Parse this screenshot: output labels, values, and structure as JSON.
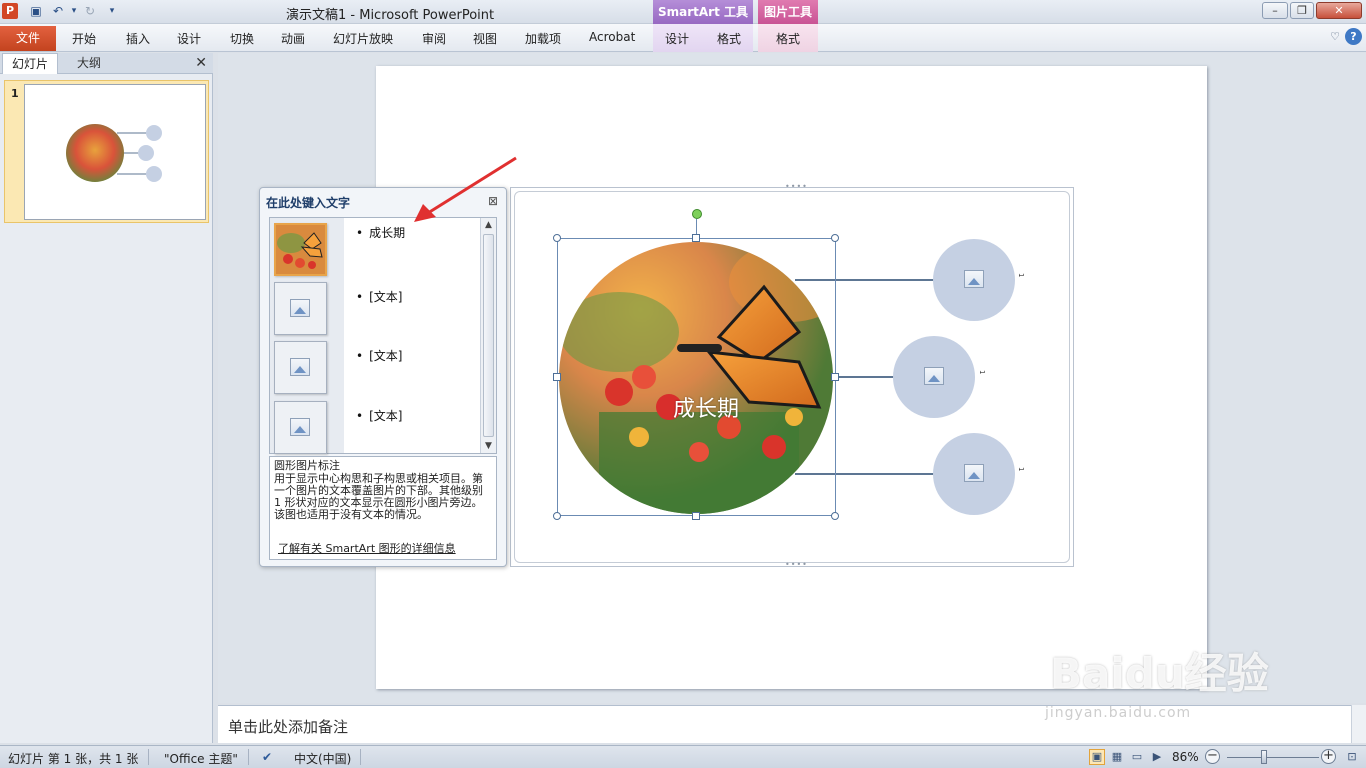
{
  "titlebar": {
    "app_icon": "P",
    "title": "演示文稿1  -  Microsoft PowerPoint",
    "contextual_tabs": {
      "smartart": "SmartArt 工具",
      "picture": "图片工具"
    }
  },
  "ribbon": {
    "tabs": [
      "文件",
      "开始",
      "插入",
      "设计",
      "切换",
      "动画",
      "幻灯片放映",
      "审阅",
      "视图",
      "加载项",
      "Acrobat",
      "设计",
      "格式",
      "格式"
    ]
  },
  "left_pane": {
    "tabs": [
      "幻灯片",
      "大纲"
    ],
    "slide_number": "1"
  },
  "smartart": {
    "center_text": "成长期",
    "placeholder_marks": [
      "1",
      "1",
      "1"
    ]
  },
  "text_pane": {
    "title": "在此处键入文字",
    "items": [
      "成长期",
      "[文本]",
      "[文本]",
      "[文本]"
    ],
    "desc_title": "圆形图片标注",
    "desc_body": "用于显示中心构思和子构思或相关项目。第一个图片的文本覆盖图片的下部。其他级别 1 形状对应的文本显示在圆形小图片旁边。该图也适用于没有文本的情况。",
    "desc_link": "了解有关 SmartArt 图形的详细信息"
  },
  "notes": {
    "placeholder": "单击此处添加备注"
  },
  "watermark": {
    "brand": "Baidu经验",
    "url": "jingyan.baidu.com"
  },
  "statusbar": {
    "slide_info": "幻灯片 第 1 张，共 1 张",
    "theme": "\"Office 主题\"",
    "language": "中文(中国)",
    "zoom": "86%",
    "zoom_fraction": 0.86
  },
  "colors": {
    "file_tab": "#c3431f",
    "smartart_tab": "#9768c2",
    "picture_tab": "#c95394",
    "small_circle": "#c5d0e3",
    "annotation_arrow": "#e03030"
  }
}
